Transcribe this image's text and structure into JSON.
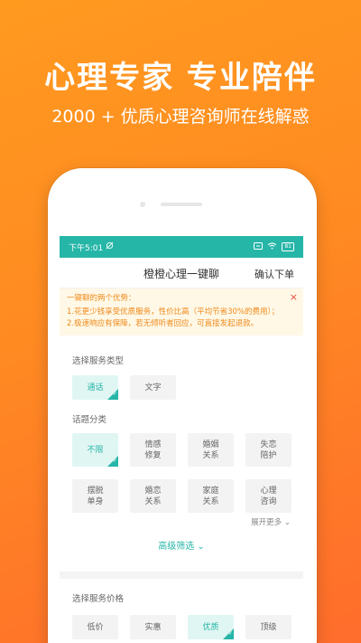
{
  "promo": {
    "headline": "心理专家 专业陪伴",
    "subline": "2000 + 优质心理咨询师在线解惑"
  },
  "status_bar": {
    "time": "下午5:01",
    "battery": "81"
  },
  "nav": {
    "title": "橙橙心理一键聊",
    "action": "确认下单"
  },
  "notice": {
    "title": "一键聊的两个优势：",
    "line1": "1.花更少钱享受优质服务，性价比高（平均节省30%的费用）；",
    "line2": "2.极速响应有保障，若无倾听者回应，可直接发起退款。",
    "close": "×"
  },
  "service_type": {
    "label": "选择服务类型",
    "options": [
      "通话",
      "文字"
    ],
    "selected": "通话"
  },
  "topic": {
    "label": "话题分类",
    "options": [
      "不限",
      "情感修复",
      "婚姻关系",
      "失恋陪护",
      "摆脱单身",
      "婚恋关系",
      "家庭关系",
      "心理咨询"
    ],
    "selected": "不限",
    "more": "展开更多 ⌄"
  },
  "advanced_filter": "高级筛选 ⌄",
  "price": {
    "label": "选择服务价格",
    "options": [
      "低价",
      "实惠",
      "优质",
      "顶级"
    ],
    "selected": "优质"
  },
  "colors": {
    "brand_orange": "#ff8a22",
    "accent_teal": "#26b6a8",
    "notice_text": "#f08a1c",
    "close_red": "#e5483a"
  }
}
